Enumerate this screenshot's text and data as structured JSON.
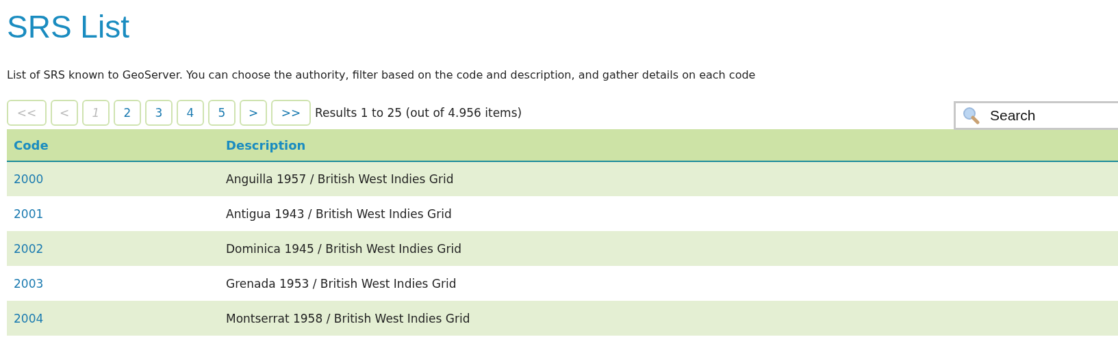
{
  "title": "SRS List",
  "description": "List of SRS known to GeoServer. You can choose the authority, filter based on the code and description, and gather details on each code",
  "pager": [
    {
      "label": "<<",
      "disabled": true
    },
    {
      "label": "<",
      "disabled": true
    },
    {
      "label": "1",
      "disabled": true,
      "selected": true
    },
    {
      "label": "2",
      "disabled": false,
      "selected": false
    },
    {
      "label": "3",
      "disabled": false,
      "selected": false
    },
    {
      "label": "4",
      "disabled": false,
      "selected": false
    },
    {
      "label": "5",
      "disabled": false,
      "selected": false
    },
    {
      "label": ">",
      "disabled": false
    },
    {
      "label": ">>",
      "disabled": false
    }
  ],
  "results": "Results 1 to 25 (out of 4.956 items)",
  "search": {
    "placeholder": "Search"
  },
  "table": {
    "columns": [
      "Code",
      "Description"
    ],
    "rows": [
      [
        "2000",
        "Anguilla 1957 / British West Indies Grid"
      ],
      [
        "2001",
        "Antigua 1943 / British West Indies Grid"
      ],
      [
        "2002",
        "Dominica 1945 / British West Indies Grid"
      ],
      [
        "2003",
        "Grenada 1953 / British West Indies Grid"
      ],
      [
        "2004",
        "Montserrat 1958 / British West Indies Grid"
      ]
    ]
  }
}
